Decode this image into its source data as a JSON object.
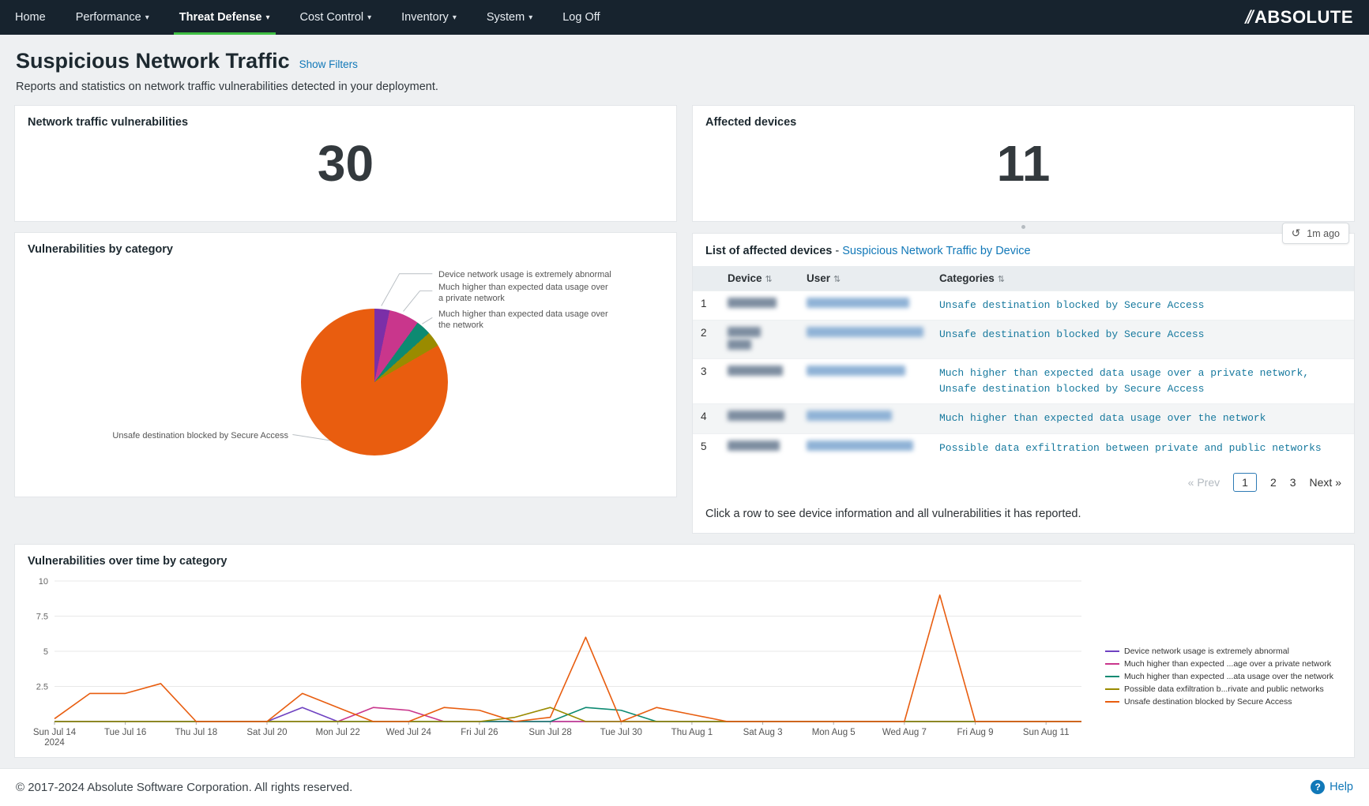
{
  "nav": {
    "items": [
      {
        "label": "Home",
        "caret": false
      },
      {
        "label": "Performance",
        "caret": true
      },
      {
        "label": "Threat Defense",
        "caret": true,
        "active": true
      },
      {
        "label": "Cost Control",
        "caret": true
      },
      {
        "label": "Inventory",
        "caret": true
      },
      {
        "label": "System",
        "caret": true
      },
      {
        "label": "Log Off",
        "caret": false
      }
    ],
    "logo": "ABSOLUTE"
  },
  "icons": {
    "caret": "▾",
    "sort": "⇅",
    "refresh": "↺",
    "help_q": "?",
    "logo_slash": "⫽"
  },
  "colors": {
    "nav_background": "#17232e",
    "nav_active_underline": "#3fbf44",
    "link_blue": "#1178b8",
    "category_text_teal": "#17799e"
  },
  "header": {
    "title": "Suspicious Network Traffic",
    "show_filters": "Show Filters",
    "subtitle": "Reports and statistics on network traffic vulnerabilities detected in your deployment."
  },
  "stats": {
    "vulnerabilities": {
      "label": "Network traffic vulnerabilities",
      "value": "30"
    },
    "affected_devices": {
      "label": "Affected devices",
      "value": "11"
    }
  },
  "device_list": {
    "title": "List of affected devices",
    "title_sep": "-",
    "title_link": "Suspicious Network Traffic by Device",
    "refresh_label": "1m ago",
    "columns": {
      "device": "Device",
      "user": "User",
      "categories": "Categories"
    },
    "rows": [
      {
        "num": "1",
        "categories": "Unsafe destination blocked by Secure Access"
      },
      {
        "num": "2",
        "categories": "Unsafe destination blocked by Secure Access"
      },
      {
        "num": "3",
        "categories": "Much higher than expected data usage over a private network, Unsafe destination blocked by Secure Access"
      },
      {
        "num": "4",
        "categories": "Much higher than expected data usage over the network"
      },
      {
        "num": "5",
        "categories": "Possible data exfiltration between private and public networks"
      }
    ],
    "pagination": {
      "prev": "« Prev",
      "pages": [
        "1",
        "2",
        "3"
      ],
      "active": "1",
      "next": "Next »"
    },
    "note": "Click a row to see device information and all vulnerabilities it has reported."
  },
  "chart_data": [
    {
      "type": "pie",
      "title": "Vulnerabilities by category",
      "total": 30,
      "slices": [
        {
          "label": "Device network usage is extremely abnormal",
          "value": 1,
          "color": "#7b2fa8"
        },
        {
          "label": "Much higher than expected data usage over a private network",
          "value": 2,
          "color": "#c9368c"
        },
        {
          "label": "Much higher than expected data usage over the network",
          "value": 1,
          "color": "#0d8a72"
        },
        {
          "label": "Possible data exfiltration between private and public networks",
          "value": 1,
          "color": "#9a8b00"
        },
        {
          "label": "Unsafe destination blocked by Secure Access",
          "value": 25,
          "color": "#e95d0f"
        }
      ]
    },
    {
      "type": "line",
      "title": "Vulnerabilities over time by category",
      "ylim": [
        0,
        10
      ],
      "yticks": [
        2.5,
        5,
        7.5,
        10
      ],
      "grid": "horizontal",
      "legend_position": "right",
      "x": [
        "Jul 14",
        "Jul 15",
        "Jul 16",
        "Jul 17",
        "Jul 18",
        "Jul 19",
        "Jul 20",
        "Jul 21",
        "Jul 22",
        "Jul 23",
        "Jul 24",
        "Jul 25",
        "Jul 26",
        "Jul 27",
        "Jul 28",
        "Jul 29",
        "Jul 30",
        "Jul 31",
        "Aug 1",
        "Aug 2",
        "Aug 3",
        "Aug 4",
        "Aug 5",
        "Aug 6",
        "Aug 7",
        "Aug 8",
        "Aug 9",
        "Aug 10",
        "Aug 11",
        "Aug 12"
      ],
      "x_ticks": [
        {
          "i": 0,
          "lines": [
            "Sun Jul 14",
            "2024"
          ]
        },
        {
          "i": 2,
          "lines": [
            "Tue Jul 16"
          ]
        },
        {
          "i": 4,
          "lines": [
            "Thu Jul 18"
          ]
        },
        {
          "i": 6,
          "lines": [
            "Sat Jul 20"
          ]
        },
        {
          "i": 8,
          "lines": [
            "Mon Jul 22"
          ]
        },
        {
          "i": 10,
          "lines": [
            "Wed Jul 24"
          ]
        },
        {
          "i": 12,
          "lines": [
            "Fri Jul 26"
          ]
        },
        {
          "i": 14,
          "lines": [
            "Sun Jul 28"
          ]
        },
        {
          "i": 16,
          "lines": [
            "Tue Jul 30"
          ]
        },
        {
          "i": 18,
          "lines": [
            "Thu Aug 1"
          ]
        },
        {
          "i": 20,
          "lines": [
            "Sat Aug 3"
          ]
        },
        {
          "i": 22,
          "lines": [
            "Mon Aug 5"
          ]
        },
        {
          "i": 24,
          "lines": [
            "Wed Aug 7"
          ]
        },
        {
          "i": 26,
          "lines": [
            "Fri Aug 9"
          ]
        },
        {
          "i": 28,
          "lines": [
            "Sun Aug 11"
          ]
        }
      ],
      "series": [
        {
          "name": "Device network usage is extremely abnormal",
          "legend": "Device network usage is extremely abnormal",
          "color": "#6f42c1",
          "values": [
            0,
            0,
            0,
            0,
            0,
            0,
            0,
            1,
            0,
            0,
            0,
            0,
            0,
            0,
            0,
            0,
            0,
            0,
            0,
            0,
            0,
            0,
            0,
            0,
            0,
            0,
            0,
            0,
            0,
            0
          ]
        },
        {
          "name": "Much higher than expected data usage over a private network",
          "legend": "Much higher than expected ...age over a private network",
          "color": "#c9368c",
          "values": [
            0,
            0,
            0,
            0,
            0,
            0,
            0,
            0,
            0,
            1,
            0.8,
            0,
            0,
            0,
            0,
            0,
            0,
            0,
            0,
            0,
            0,
            0,
            0,
            0,
            0,
            0,
            0,
            0,
            0,
            0
          ]
        },
        {
          "name": "Much higher than expected data usage over the network",
          "legend": "Much higher than expected ...ata usage over the network",
          "color": "#0d8a72",
          "values": [
            0,
            0,
            0,
            0,
            0,
            0,
            0,
            0,
            0,
            0,
            0,
            0,
            0,
            0,
            0,
            1,
            0.8,
            0,
            0,
            0,
            0,
            0,
            0,
            0,
            0,
            0,
            0,
            0,
            0,
            0
          ]
        },
        {
          "name": "Possible data exfiltration between private and public networks",
          "legend": "Possible data exfiltration b...rivate and public networks",
          "color": "#9a8b00",
          "values": [
            0,
            0,
            0,
            0,
            0,
            0,
            0,
            0,
            0,
            0,
            0,
            0,
            0,
            0.3,
            1,
            0,
            0,
            0,
            0,
            0,
            0,
            0,
            0,
            0,
            0,
            0,
            0,
            0,
            0,
            0
          ]
        },
        {
          "name": "Unsafe destination blocked by Secure Access",
          "legend": "Unsafe destination blocked by Secure Access",
          "color": "#e85d0f",
          "values": [
            0.2,
            2,
            2,
            2.7,
            0,
            0,
            0,
            2,
            1,
            0,
            0,
            1,
            0.8,
            0,
            0.3,
            6,
            0,
            1,
            0.5,
            0,
            0,
            0,
            0,
            0,
            0,
            9,
            0,
            0,
            0,
            0
          ]
        }
      ]
    }
  ],
  "footer": {
    "copyright": "© 2017-2024 Absolute Software Corporation. All rights reserved.",
    "help": "Help"
  }
}
